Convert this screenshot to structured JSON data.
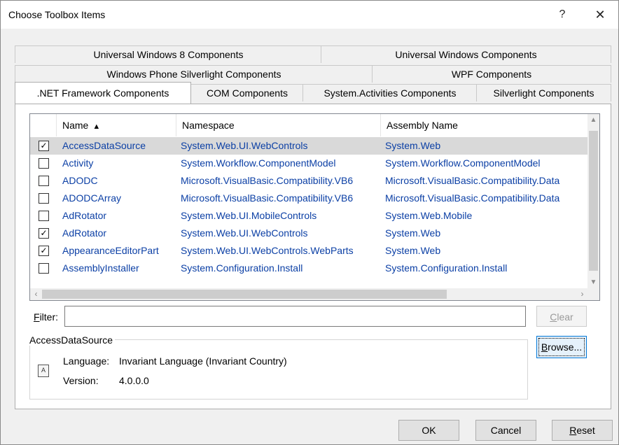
{
  "window": {
    "title": "Choose Toolbox Items",
    "help_glyph": "?",
    "close_glyph": "✕"
  },
  "tabs": {
    "row1": [
      "Universal Windows 8 Components",
      "Universal Windows Components"
    ],
    "row2": [
      "Windows Phone Silverlight Components",
      "WPF Components"
    ],
    "row3": [
      ".NET Framework Components",
      "COM Components",
      "System.Activities Components",
      "Silverlight Components"
    ],
    "active": ".NET Framework Components"
  },
  "list": {
    "headers": {
      "name": "Name",
      "sort_glyph": "▲",
      "namespace": "Namespace",
      "assembly": "Assembly Name"
    },
    "rows": [
      {
        "checked": true,
        "name": "AccessDataSource",
        "namespace": "System.Web.UI.WebControls",
        "assembly": "System.Web",
        "selected": true
      },
      {
        "checked": false,
        "name": "Activity",
        "namespace": "System.Workflow.ComponentModel",
        "assembly": "System.Workflow.ComponentModel"
      },
      {
        "checked": false,
        "name": "ADODC",
        "namespace": "Microsoft.VisualBasic.Compatibility.VB6",
        "assembly": "Microsoft.VisualBasic.Compatibility.Data"
      },
      {
        "checked": false,
        "name": "ADODCArray",
        "namespace": "Microsoft.VisualBasic.Compatibility.VB6",
        "assembly": "Microsoft.VisualBasic.Compatibility.Data"
      },
      {
        "checked": false,
        "name": "AdRotator",
        "namespace": "System.Web.UI.MobileControls",
        "assembly": "System.Web.Mobile"
      },
      {
        "checked": true,
        "name": "AdRotator",
        "namespace": "System.Web.UI.WebControls",
        "assembly": "System.Web"
      },
      {
        "checked": true,
        "name": "AppearanceEditorPart",
        "namespace": "System.Web.UI.WebControls.WebParts",
        "assembly": "System.Web"
      },
      {
        "checked": false,
        "name": "AssemblyInstaller",
        "namespace": "System.Configuration.Install",
        "assembly": "System.Configuration.Install"
      }
    ]
  },
  "filter": {
    "label_accel": "F",
    "label_rest": "ilter:",
    "value": "",
    "clear_accel": "C",
    "clear_rest": "lear"
  },
  "info": {
    "title": "AccessDataSource",
    "language_label": "Language:",
    "language_value": "Invariant Language (Invariant Country)",
    "version_label": "Version:",
    "version_value": "4.0.0.0",
    "icon_text": "A",
    "browse_accel": "B",
    "browse_rest": "rowse..."
  },
  "footer": {
    "ok": "OK",
    "cancel": "Cancel",
    "reset_accel": "R",
    "reset_rest": "eset"
  },
  "colors": {
    "link_text": "#0b3fa5",
    "selected_row": "#d9d9d9",
    "focus_border": "#0078d7"
  }
}
